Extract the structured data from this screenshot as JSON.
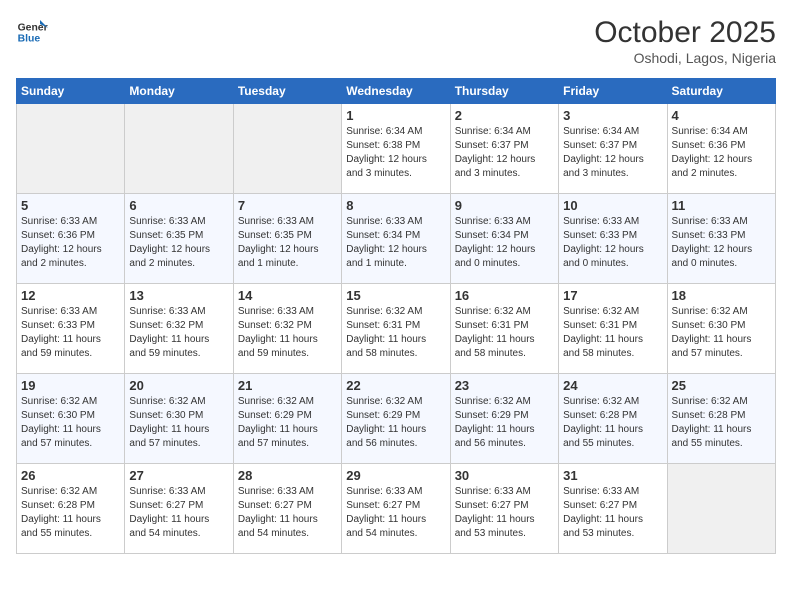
{
  "header": {
    "logo_line1": "General",
    "logo_line2": "Blue",
    "month": "October 2025",
    "location": "Oshodi, Lagos, Nigeria"
  },
  "days_of_week": [
    "Sunday",
    "Monday",
    "Tuesday",
    "Wednesday",
    "Thursday",
    "Friday",
    "Saturday"
  ],
  "weeks": [
    [
      {
        "day": "",
        "info": ""
      },
      {
        "day": "",
        "info": ""
      },
      {
        "day": "",
        "info": ""
      },
      {
        "day": "1",
        "info": "Sunrise: 6:34 AM\nSunset: 6:38 PM\nDaylight: 12 hours\nand 3 minutes."
      },
      {
        "day": "2",
        "info": "Sunrise: 6:34 AM\nSunset: 6:37 PM\nDaylight: 12 hours\nand 3 minutes."
      },
      {
        "day": "3",
        "info": "Sunrise: 6:34 AM\nSunset: 6:37 PM\nDaylight: 12 hours\nand 3 minutes."
      },
      {
        "day": "4",
        "info": "Sunrise: 6:34 AM\nSunset: 6:36 PM\nDaylight: 12 hours\nand 2 minutes."
      }
    ],
    [
      {
        "day": "5",
        "info": "Sunrise: 6:33 AM\nSunset: 6:36 PM\nDaylight: 12 hours\nand 2 minutes."
      },
      {
        "day": "6",
        "info": "Sunrise: 6:33 AM\nSunset: 6:35 PM\nDaylight: 12 hours\nand 2 minutes."
      },
      {
        "day": "7",
        "info": "Sunrise: 6:33 AM\nSunset: 6:35 PM\nDaylight: 12 hours\nand 1 minute."
      },
      {
        "day": "8",
        "info": "Sunrise: 6:33 AM\nSunset: 6:34 PM\nDaylight: 12 hours\nand 1 minute."
      },
      {
        "day": "9",
        "info": "Sunrise: 6:33 AM\nSunset: 6:34 PM\nDaylight: 12 hours\nand 0 minutes."
      },
      {
        "day": "10",
        "info": "Sunrise: 6:33 AM\nSunset: 6:33 PM\nDaylight: 12 hours\nand 0 minutes."
      },
      {
        "day": "11",
        "info": "Sunrise: 6:33 AM\nSunset: 6:33 PM\nDaylight: 12 hours\nand 0 minutes."
      }
    ],
    [
      {
        "day": "12",
        "info": "Sunrise: 6:33 AM\nSunset: 6:33 PM\nDaylight: 11 hours\nand 59 minutes."
      },
      {
        "day": "13",
        "info": "Sunrise: 6:33 AM\nSunset: 6:32 PM\nDaylight: 11 hours\nand 59 minutes."
      },
      {
        "day": "14",
        "info": "Sunrise: 6:33 AM\nSunset: 6:32 PM\nDaylight: 11 hours\nand 59 minutes."
      },
      {
        "day": "15",
        "info": "Sunrise: 6:32 AM\nSunset: 6:31 PM\nDaylight: 11 hours\nand 58 minutes."
      },
      {
        "day": "16",
        "info": "Sunrise: 6:32 AM\nSunset: 6:31 PM\nDaylight: 11 hours\nand 58 minutes."
      },
      {
        "day": "17",
        "info": "Sunrise: 6:32 AM\nSunset: 6:31 PM\nDaylight: 11 hours\nand 58 minutes."
      },
      {
        "day": "18",
        "info": "Sunrise: 6:32 AM\nSunset: 6:30 PM\nDaylight: 11 hours\nand 57 minutes."
      }
    ],
    [
      {
        "day": "19",
        "info": "Sunrise: 6:32 AM\nSunset: 6:30 PM\nDaylight: 11 hours\nand 57 minutes."
      },
      {
        "day": "20",
        "info": "Sunrise: 6:32 AM\nSunset: 6:30 PM\nDaylight: 11 hours\nand 57 minutes."
      },
      {
        "day": "21",
        "info": "Sunrise: 6:32 AM\nSunset: 6:29 PM\nDaylight: 11 hours\nand 57 minutes."
      },
      {
        "day": "22",
        "info": "Sunrise: 6:32 AM\nSunset: 6:29 PM\nDaylight: 11 hours\nand 56 minutes."
      },
      {
        "day": "23",
        "info": "Sunrise: 6:32 AM\nSunset: 6:29 PM\nDaylight: 11 hours\nand 56 minutes."
      },
      {
        "day": "24",
        "info": "Sunrise: 6:32 AM\nSunset: 6:28 PM\nDaylight: 11 hours\nand 55 minutes."
      },
      {
        "day": "25",
        "info": "Sunrise: 6:32 AM\nSunset: 6:28 PM\nDaylight: 11 hours\nand 55 minutes."
      }
    ],
    [
      {
        "day": "26",
        "info": "Sunrise: 6:32 AM\nSunset: 6:28 PM\nDaylight: 11 hours\nand 55 minutes."
      },
      {
        "day": "27",
        "info": "Sunrise: 6:33 AM\nSunset: 6:27 PM\nDaylight: 11 hours\nand 54 minutes."
      },
      {
        "day": "28",
        "info": "Sunrise: 6:33 AM\nSunset: 6:27 PM\nDaylight: 11 hours\nand 54 minutes."
      },
      {
        "day": "29",
        "info": "Sunrise: 6:33 AM\nSunset: 6:27 PM\nDaylight: 11 hours\nand 54 minutes."
      },
      {
        "day": "30",
        "info": "Sunrise: 6:33 AM\nSunset: 6:27 PM\nDaylight: 11 hours\nand 53 minutes."
      },
      {
        "day": "31",
        "info": "Sunrise: 6:33 AM\nSunset: 6:27 PM\nDaylight: 11 hours\nand 53 minutes."
      },
      {
        "day": "",
        "info": ""
      }
    ]
  ]
}
